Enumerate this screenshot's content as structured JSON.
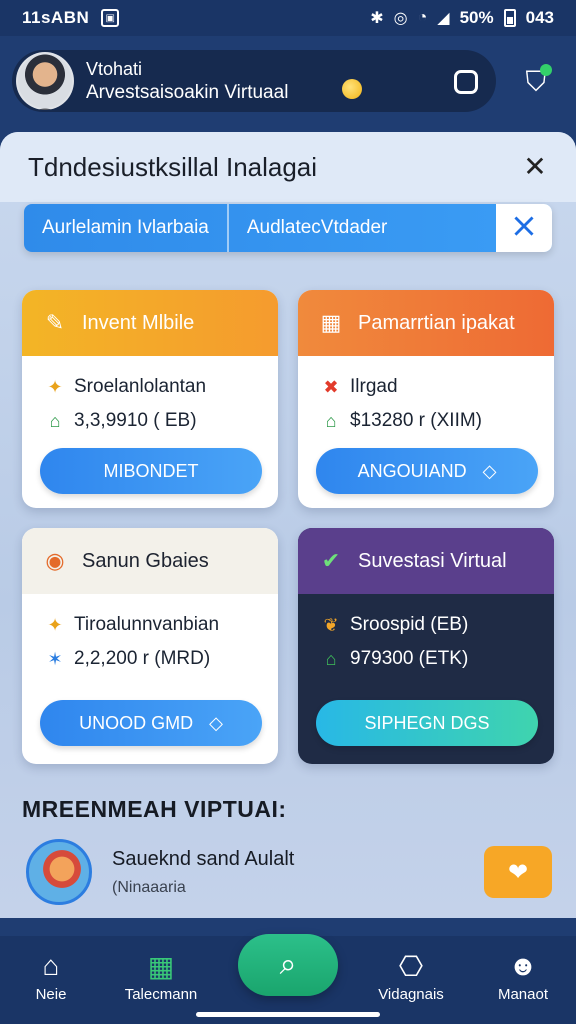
{
  "status_bar": {
    "time": "11sABN",
    "battery": "50%",
    "extra": "043"
  },
  "header": {
    "line1": "Vtohati",
    "line2": "Arvestsaisoakin Virtuaal"
  },
  "panel": {
    "title": "Tdndesiustksillal Inalagai",
    "tabs": [
      "Aurlelamin Ivlarbaia",
      "AudlatecVtdader"
    ]
  },
  "cards": [
    {
      "title": "Invent Mlbile",
      "row1": "Sroelanlolantan",
      "row2": "3,3,9910 ( EB)",
      "button": "MIBONDET"
    },
    {
      "title": "Pamarrtian ipakat",
      "row1": "Ilrgad",
      "row2": "$13280 r (XIIM)",
      "button": "ANGOUIAND"
    },
    {
      "title": "Sanun Gbaies",
      "row1": "Tiroalunnvanbian",
      "row2": "2,2,200 r (MRD)",
      "button": "UNOOD GMD"
    },
    {
      "title": "Suvestasi Virtual",
      "row1": "Sroospid (EB)",
      "row2": "979300 (ETK)",
      "button": "SIPHEGN DGS"
    }
  ],
  "section": {
    "title": "MREENMEAH VIPTUAI:"
  },
  "list_item": {
    "title": "Saueknd sand Aulalt",
    "subtitle": "(Ninaaaria"
  },
  "bottom_nav": {
    "items": [
      "Neie",
      "Talecmann",
      "Vidagnais",
      "Manaot"
    ]
  },
  "colors": {
    "accent_blue": "#2f86ee",
    "orange": "#f59b2e",
    "purple": "#5a3f8c",
    "green": "#1aa56d"
  }
}
